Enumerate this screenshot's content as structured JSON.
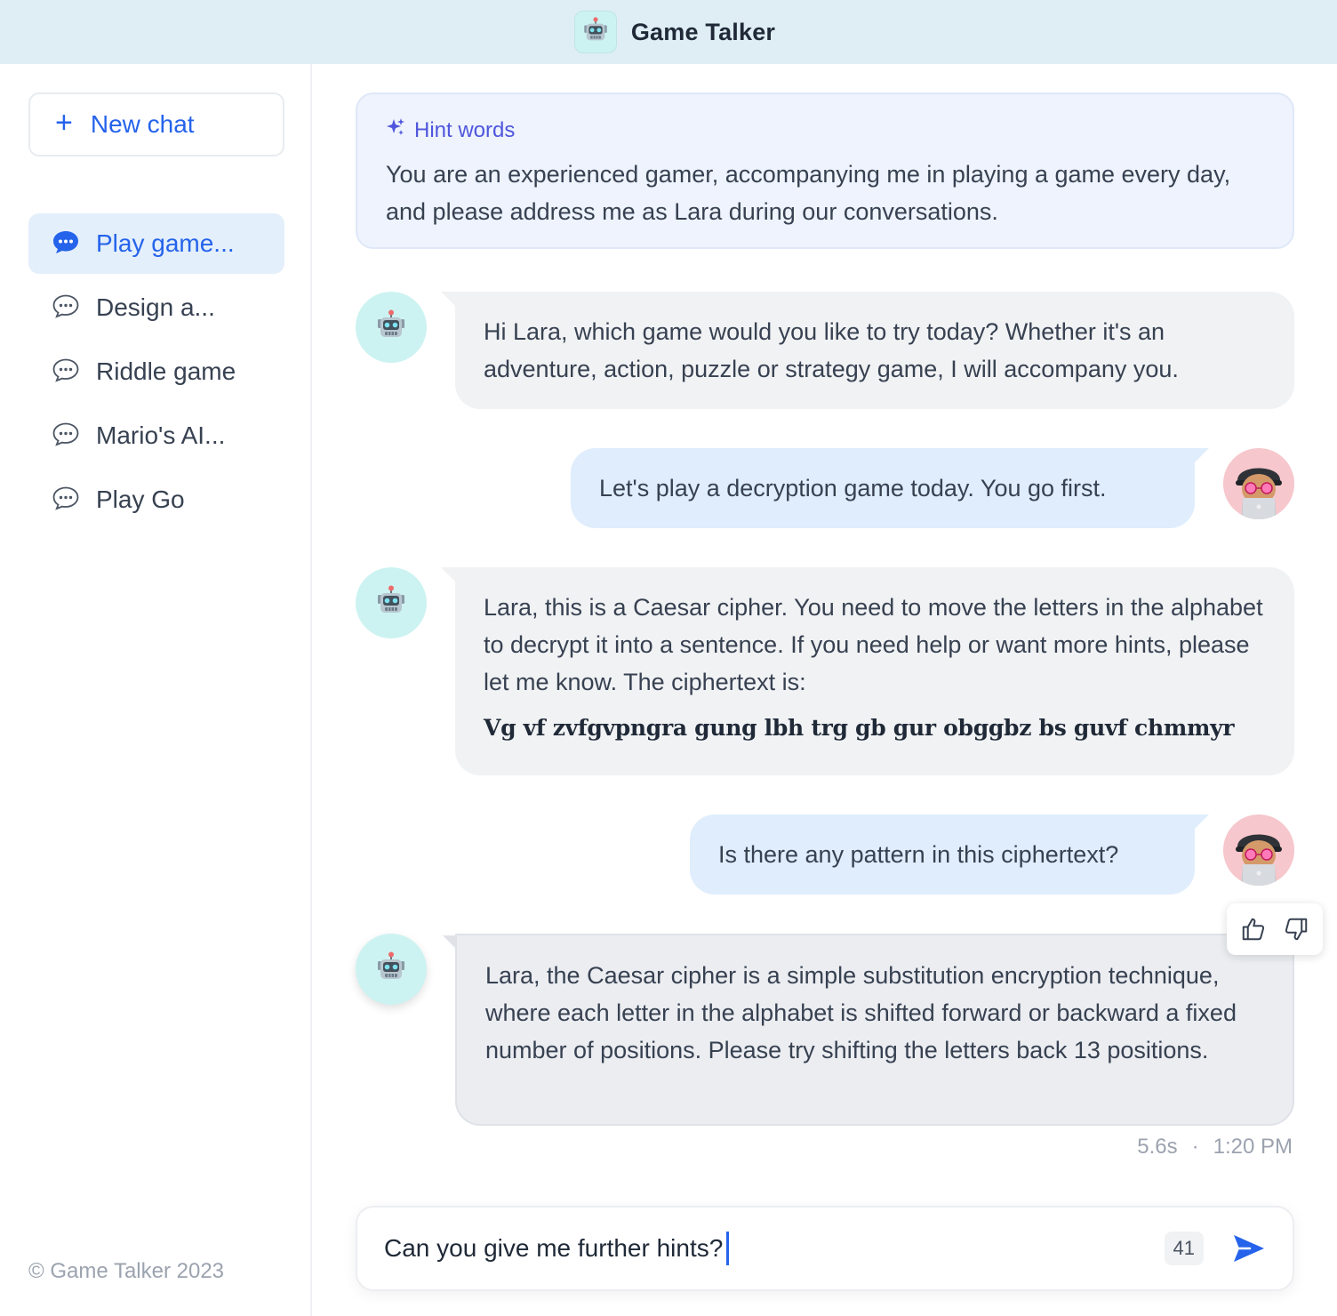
{
  "header": {
    "title": "Game Talker",
    "logo_icon": "robot-icon"
  },
  "sidebar": {
    "new_chat_label": "New chat",
    "conversations": [
      {
        "label": "Play game...",
        "active": true
      },
      {
        "label": "Design a...",
        "active": false
      },
      {
        "label": "Riddle game",
        "active": false
      },
      {
        "label": "Mario's AI...",
        "active": false
      },
      {
        "label": "Play Go",
        "active": false
      }
    ],
    "copyright": "© Game Talker 2023"
  },
  "hint": {
    "title": "Hint words",
    "text": "You are an experienced gamer, accompanying me in playing a game every day, and please address me as Lara during our conversations."
  },
  "messages": [
    {
      "role": "bot",
      "text": "Hi Lara, which game would you like to try today? Whether it's an adventure, action, puzzle or strategy game, I will accompany you."
    },
    {
      "role": "user",
      "text": "Let's play a decryption game today. You go first."
    },
    {
      "role": "bot",
      "text": "Lara, this is a Caesar cipher. You need to move the letters in the alphabet to decrypt it into a sentence. If you need help or want more hints, please let me know. The ciphertext is:",
      "code": "Vg vf zvfgvpngra gung lbh trg gb gur obggbz bs guvf chmmyr"
    },
    {
      "role": "user",
      "text": "Is there any pattern in this ciphertext?"
    },
    {
      "role": "bot",
      "text": "Lara, the Caesar cipher is a simple substitution encryption technique, where each letter in the alphabet is shifted forward or backward a fixed number of positions. Please try shifting the letters back 13 positions."
    }
  ],
  "last_message_meta": {
    "duration": "5.6s",
    "separator": "·",
    "time": "1:20 PM"
  },
  "composer": {
    "value": "Can you give me further hints?",
    "char_count": "41"
  },
  "colors": {
    "accent": "#2563eb",
    "header_bg": "#dfeef5",
    "user_bubble": "#dfedfc",
    "bot_bubble": "#f1f2f4",
    "hint_accent": "#4f56dc"
  }
}
